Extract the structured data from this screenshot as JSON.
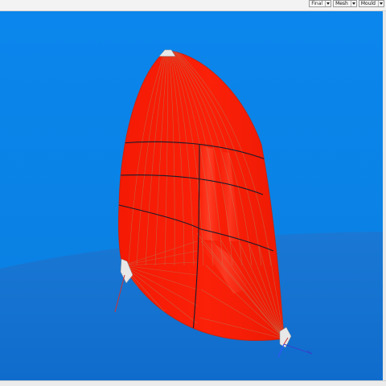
{
  "toolbar": {
    "modes": [
      {
        "label": "Final",
        "selected": true,
        "icon": "chevron-down-icon"
      },
      {
        "label": "Mesh",
        "selected": false,
        "icon": "chevron-down-icon"
      },
      {
        "label": "Mould",
        "selected": false,
        "icon": "chevron-down-icon"
      }
    ]
  },
  "viewport": {
    "background_color": "#0a84e8",
    "floor_color": "#1577d6",
    "sail_color": "#f81c06",
    "panel_line_color": "#c46a4a",
    "seam_color": "#1a1a2a",
    "corner_reinforcement_color": "#e8e8e8",
    "axis_colors": {
      "x": "#3344cc",
      "y": "#cc3333",
      "z": "#3355ff"
    }
  }
}
